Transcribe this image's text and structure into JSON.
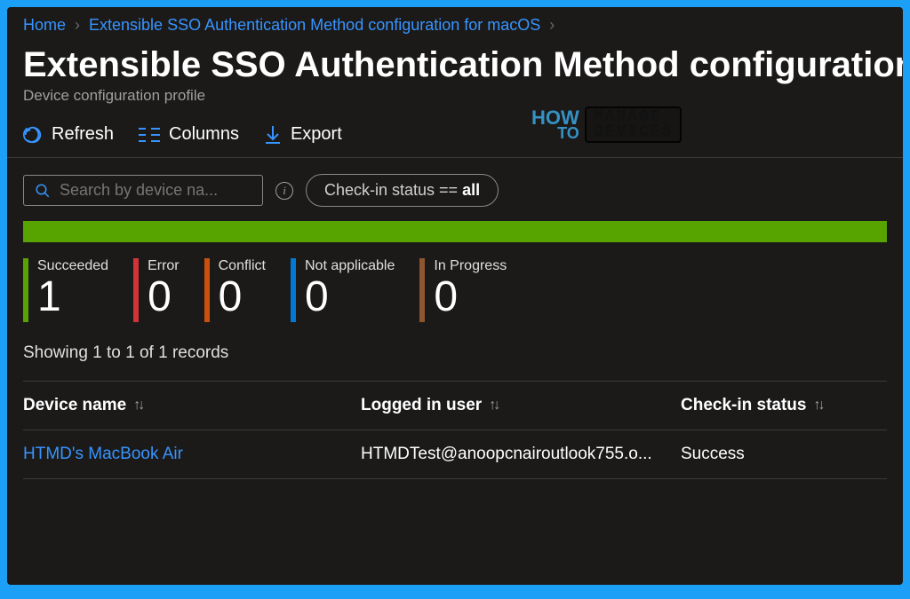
{
  "breadcrumb": {
    "home": "Home",
    "current": "Extensible SSO Authentication Method configuration for macOS"
  },
  "header": {
    "title": "Extensible SSO Authentication Method configuration",
    "subtitle": "Device configuration profile"
  },
  "toolbar": {
    "refresh": "Refresh",
    "columns": "Columns",
    "export": "Export"
  },
  "filters": {
    "search_placeholder": "Search by device na...",
    "checkin_pill_label": "Check-in status == ",
    "checkin_pill_value": "all"
  },
  "stats": [
    {
      "label": "Succeeded",
      "value": "1",
      "colorClass": "c-green"
    },
    {
      "label": "Error",
      "value": "0",
      "colorClass": "c-red"
    },
    {
      "label": "Conflict",
      "value": "0",
      "colorClass": "c-orange"
    },
    {
      "label": "Not applicable",
      "value": "0",
      "colorClass": "c-blue"
    },
    {
      "label": "In Progress",
      "value": "0",
      "colorClass": "c-brown"
    }
  ],
  "records_text": "Showing 1 to 1 of 1 records",
  "table": {
    "headers": {
      "device": "Device name",
      "user": "Logged in user",
      "status": "Check-in status"
    },
    "rows": [
      {
        "device": "HTMD's MacBook Air",
        "user": "HTMDTest@anoopcnairoutlook755.o...",
        "status": "Success"
      }
    ]
  },
  "watermark": {
    "how": "HOW",
    "to": "TO",
    "line1": "MANAGE",
    "line2": "DEVICES"
  }
}
